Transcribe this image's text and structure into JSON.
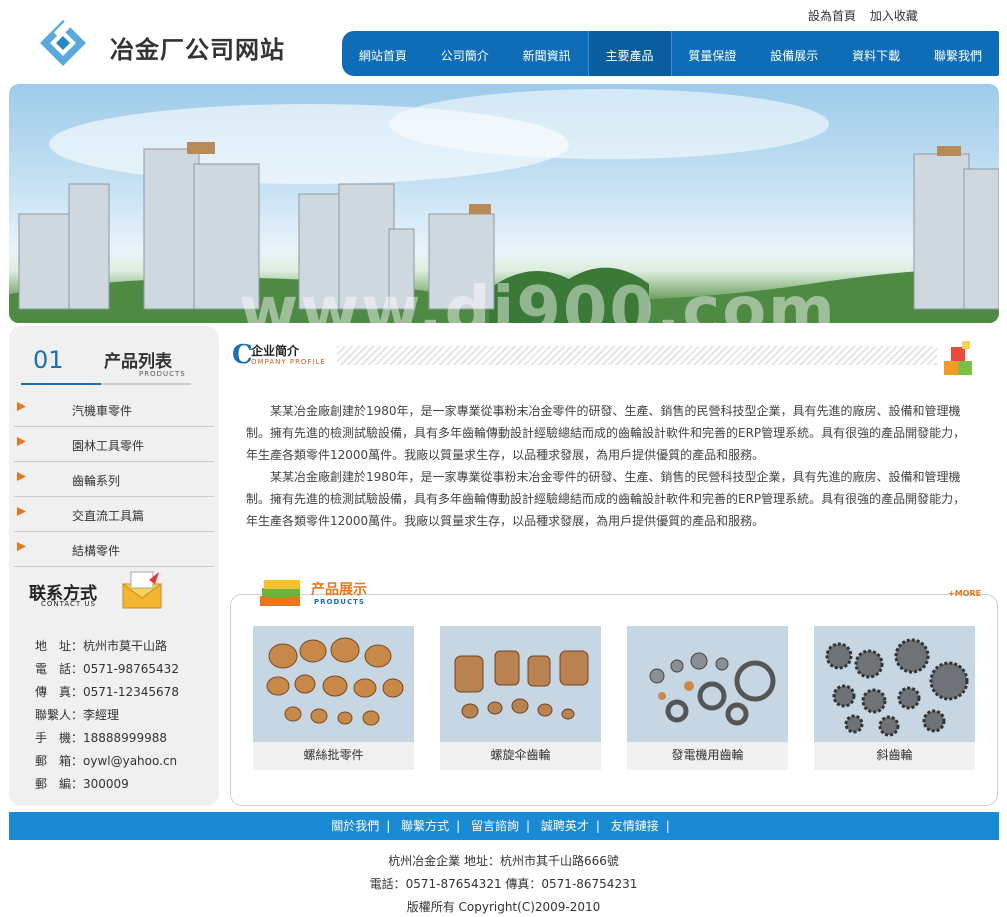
{
  "site": {
    "name": "冶金厂公司网站"
  },
  "toplinks": {
    "home": "設為首頁",
    "favorite": "加入收藏"
  },
  "nav": [
    "網站首頁",
    "公司簡介",
    "新聞資訊",
    "主要產品",
    "質量保證",
    "設備展示",
    "資料下載",
    "聯繫我們"
  ],
  "banner": {
    "watermark": "www.di900.com"
  },
  "sidebar": {
    "num": "01",
    "title": "产品列表",
    "subtitle": "PRODUCTS",
    "items": [
      "汽機車零件",
      "園林工具零件",
      "齒輪系列",
      "交直流工具篇",
      "結構零件"
    ]
  },
  "contact": {
    "title": "联系方式",
    "subtitle": "CONTACT US",
    "rows": [
      "地　址：杭州市莫干山路",
      "電　話：0571-98765432",
      "傳　真：0571-12345678",
      "聯繫人：李經理",
      "手　機：18888999988",
      "郵　箱：oywl@yahoo.cn",
      "郵　編：300009"
    ]
  },
  "company": {
    "letter": "C",
    "title": "企业简介",
    "subtitle": "OMPANY PROFILE",
    "paragraphs": [
      "某某冶金廠創建於1980年，是一家專業從事粉末冶金零件的研發、生產、銷售的民營科技型企業，具有先進的廠房、設備和管理機制。擁有先進的檢測試驗設備，具有多年齒輪傳動設計經驗總結而成的齒輪設計軟件和完善的ERP管理系統。具有很強的產品開發能力，年生產各類零件12000萬件。我廠以質量求生存，以品種求發展，為用戶提供優質的產品和服務。",
      "某某冶金廠創建於1980年，是一家專業從事粉末冶金零件的研發、生產、銷售的民營科技型企業，具有先進的廠房、設備和管理機制。擁有先進的檢測試驗設備，具有多年齒輪傳動設計經驗總結而成的齒輪設計軟件和完善的ERP管理系統。具有很強的產品開發能力，年生產各類零件12000萬件。我廠以質量求生存，以品種求發展，為用戶提供優質的產品和服務。"
    ]
  },
  "products": {
    "title": "产品展示",
    "subtitle": "PRODUCTS",
    "more": "+MORE",
    "items": [
      "螺絲批零件",
      "螺旋伞齒輪",
      "發電機用齒輪",
      "斜齒輪"
    ]
  },
  "footer": {
    "links": [
      "關於我們",
      "聯繫方式",
      "留言諮詢",
      "誠聘英才",
      "友情鏈接"
    ],
    "lines": [
      "杭州冶金企業 地址：杭州市其千山路666號",
      "電話：0571-87654321 傳真：0571-86754231",
      "版權所有 Copyright(C)2009-2010"
    ]
  },
  "colors": {
    "primary": "#0f6db8",
    "footer_bar": "#1a8ad4",
    "accent": "#e8761a"
  }
}
